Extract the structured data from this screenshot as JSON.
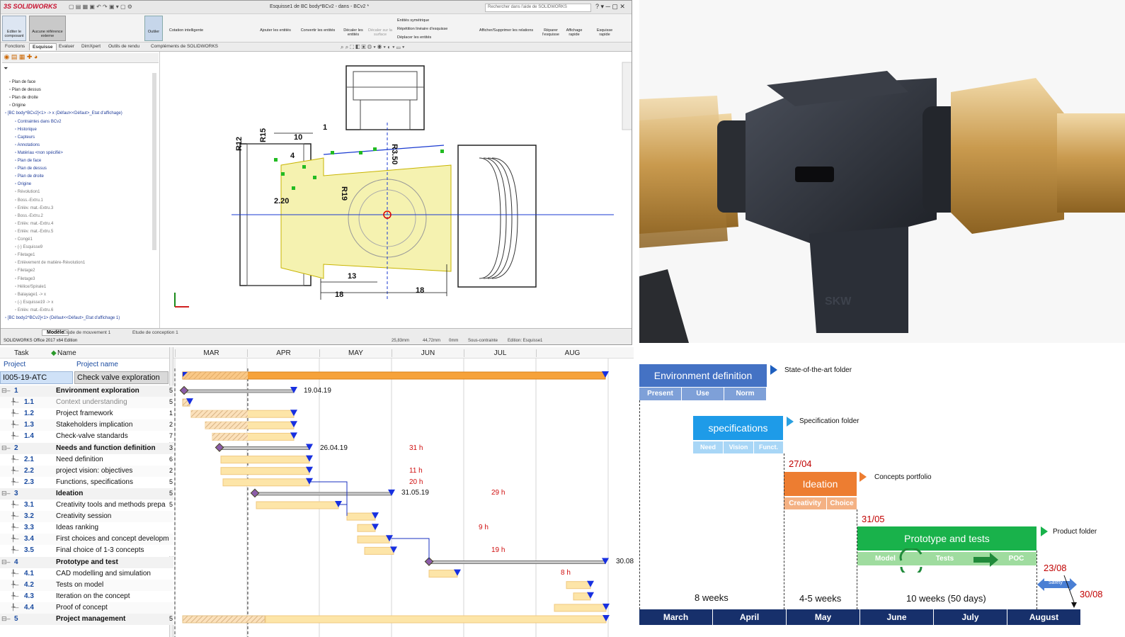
{
  "solidworks": {
    "logo": "3S SOLIDWORKS",
    "title": "Esquisse1 de BC body*BCv2 - dans - BCv2 *",
    "search_placeholder": "Rechercher dans l'aide de SOLIDWORKS",
    "ribbon": [
      "Editer le composant",
      "Aucune référence externe",
      "Outiler",
      "Cotation intelligente",
      "Ajouter les entités",
      "Convertir les entités",
      "Décaler les entités",
      "Décaler sur la surface",
      "Entités symétrique",
      "Répétition linéaire d'esquisse",
      "Déplacer les entités",
      "Afficher/Supprimer les relations",
      "Réparer l'esquisse",
      "Affichage rapide",
      "Esquisse rapide"
    ],
    "tabs": [
      "Fonctions",
      "Esquisse",
      "Evaluer",
      "DimXpert",
      "Outils de rendu",
      "Compléments de SOLIDWORKS"
    ],
    "tree": [
      {
        "label": "Plan de face",
        "style": "k"
      },
      {
        "label": "Plan de dessus",
        "style": "k"
      },
      {
        "label": "Plan de droite",
        "style": "k"
      },
      {
        "label": "Origine",
        "style": "k"
      },
      {
        "label": "[BC body^BCv2]<1> -> x (Défaut<<Défaut>_Etat d'affichage)",
        "style": "b"
      },
      {
        "label": "Contraintes dans BCv2",
        "style": "b"
      },
      {
        "label": "Historique",
        "style": "b"
      },
      {
        "label": "Capteurs",
        "style": "b"
      },
      {
        "label": "Annotations",
        "style": "b"
      },
      {
        "label": "Matériau <non spécifié>",
        "style": "b"
      },
      {
        "label": "Plan de face",
        "style": "b"
      },
      {
        "label": "Plan de dessus",
        "style": "b"
      },
      {
        "label": "Plan de droite",
        "style": "b"
      },
      {
        "label": "Origine",
        "style": "b"
      },
      {
        "label": "Révolution1",
        "style": "g"
      },
      {
        "label": "Boss.-Extru.1",
        "style": "g"
      },
      {
        "label": "Enlèv. mat.-Extru.3",
        "style": "g"
      },
      {
        "label": "Boss.-Extru.2",
        "style": "g"
      },
      {
        "label": "Enlèv. mat.-Extru.4",
        "style": "g"
      },
      {
        "label": "Enlèv. mat.-Extru.5",
        "style": "g"
      },
      {
        "label": "Congé1",
        "style": "g"
      },
      {
        "label": "(-) Esquisse9",
        "style": "g"
      },
      {
        "label": "Filetage1",
        "style": "g"
      },
      {
        "label": "Enlèvement de matière-Révolution1",
        "style": "g"
      },
      {
        "label": "Filetage2",
        "style": "g"
      },
      {
        "label": "Filetage3",
        "style": "g"
      },
      {
        "label": "Hélice/Spirale1",
        "style": "g"
      },
      {
        "label": "Balayage1 -> x",
        "style": "g"
      },
      {
        "label": "(-) Esquisse19 -> x",
        "style": "g"
      },
      {
        "label": "Enlèv. mat.-Extru.6",
        "style": "g"
      },
      {
        "label": "[BC body2^BCv2]<1> (Défaut<<Défaut>_Etat d'affichage 1)",
        "style": "b"
      }
    ],
    "dims": [
      "R12",
      "R15",
      "10",
      "1",
      "R3.50",
      "2.20",
      "R19",
      "13",
      "18",
      "18",
      "4"
    ],
    "bottom_tabs": [
      "Modèle",
      "Etude de mouvement 1",
      "Etude de conception 1"
    ],
    "status": [
      "25,83mm",
      "44,72mm",
      "0mm",
      "Sous-contrainte",
      "Edition: Esquisse1"
    ],
    "version": "SOLIDWORKS Office 2017 x64 Edition"
  },
  "gantt": {
    "col_task": "Task",
    "col_name": "Name",
    "col_project": "Project",
    "col_project_name": "Project name",
    "project_id": "I005-19-ATC",
    "project_name": "Check valve exploration",
    "months": [
      "MAR",
      "APR",
      "MAY",
      "JUN",
      "JUL",
      "AUG"
    ],
    "rows": [
      {
        "id": "1",
        "name": "Environment exploration",
        "n": "5",
        "summary": true
      },
      {
        "id": "1.1",
        "name": "Context understanding",
        "n": "5",
        "summary": false,
        "grey": true
      },
      {
        "id": "1.2",
        "name": "Project framework",
        "n": "1",
        "summary": false
      },
      {
        "id": "1.3",
        "name": "Stakeholders implication",
        "n": "2",
        "summary": false
      },
      {
        "id": "1.4",
        "name": "Check-valve standards",
        "n": "7",
        "summary": false
      },
      {
        "id": "2",
        "name": "Needs and function definition",
        "n": "3",
        "summary": true
      },
      {
        "id": "2.1",
        "name": "Need definition",
        "n": "6",
        "summary": false
      },
      {
        "id": "2.2",
        "name": "project vision: objectives",
        "n": "2",
        "summary": false
      },
      {
        "id": "2.3",
        "name": "Functions, specifications",
        "n": "5",
        "summary": false
      },
      {
        "id": "3",
        "name": "Ideation",
        "n": "5",
        "summary": true
      },
      {
        "id": "3.1",
        "name": "Creativity tools and methods prepa",
        "n": "5",
        "summary": false
      },
      {
        "id": "3.2",
        "name": "Creativity session",
        "n": "",
        "summary": false
      },
      {
        "id": "3.3",
        "name": "Ideas ranking",
        "n": "",
        "summary": false
      },
      {
        "id": "3.4",
        "name": "First choices and concept developm",
        "n": "",
        "summary": false
      },
      {
        "id": "3.5",
        "name": "Final choice of 1-3 concepts",
        "n": "",
        "summary": false
      },
      {
        "id": "4",
        "name": "Prototype and test",
        "n": "",
        "summary": true
      },
      {
        "id": "4.1",
        "name": "CAD modelling and simulation",
        "n": "",
        "summary": false
      },
      {
        "id": "4.2",
        "name": "Tests on model",
        "n": "",
        "summary": false
      },
      {
        "id": "4.3",
        "name": "Iteration on the concept",
        "n": "",
        "summary": false
      },
      {
        "id": "4.4",
        "name": "Proof of concept",
        "n": "",
        "summary": false
      },
      {
        "id": "5",
        "name": "Project management",
        "n": "5",
        "summary": true
      }
    ],
    "date_labels": [
      "19.04.19",
      "26.04.19",
      "31.05.19",
      "30.08"
    ],
    "hour_labels": [
      "31 h",
      "11 h",
      "20 h",
      "29 h",
      "9 h",
      "19 h",
      "8 h"
    ]
  },
  "timeline": {
    "phases": [
      {
        "title": "Environment definition",
        "color": "#4472c4",
        "subs": [
          "Present",
          "Use",
          "Norm"
        ],
        "folder": "State-of-the-art folder"
      },
      {
        "title": "specifications",
        "color": "#1e9be8",
        "subs": [
          "Need",
          "Vision",
          "Funct."
        ],
        "folder": "Specification folder"
      },
      {
        "title": "Ideation",
        "color": "#ed7d31",
        "subs": [
          "Creativity",
          "Choice"
        ],
        "folder": "Concepts portfolio"
      },
      {
        "title": "Prototype and tests",
        "color": "#19b24b",
        "subs": [
          "Model",
          "Tests",
          "POC"
        ],
        "folder": "Product folder"
      }
    ],
    "safety": "Safety",
    "deadlines": [
      "27/04",
      "31/05",
      "23/08",
      "30/08"
    ],
    "durations": [
      "8 weeks",
      "4-5 weeks",
      "10 weeks (50 days)"
    ],
    "months": [
      "March",
      "April",
      "May",
      "June",
      "July",
      "August"
    ],
    "month_color": "#17306b"
  }
}
